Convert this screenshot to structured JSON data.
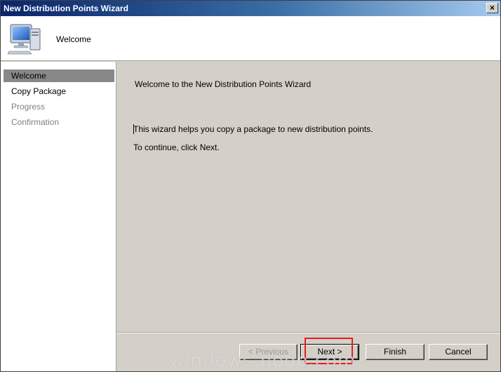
{
  "window": {
    "title": "New Distribution Points Wizard",
    "close_label": "×"
  },
  "header": {
    "title": "Welcome",
    "icon": "computer-icon"
  },
  "sidebar": {
    "items": [
      {
        "label": "Welcome",
        "state": "active"
      },
      {
        "label": "Copy Package",
        "state": "enabled"
      },
      {
        "label": "Progress",
        "state": "disabled"
      },
      {
        "label": "Confirmation",
        "state": "disabled"
      }
    ]
  },
  "content": {
    "heading": "Welcome to the New Distribution Points Wizard",
    "description": "This wizard helps you copy a package to new distribution points.",
    "continue_text": "To continue, click Next."
  },
  "footer": {
    "previous_label": "< Previous",
    "next_label": "Next >",
    "finish_label": "Finish",
    "cancel_label": "Cancel"
  },
  "watermark": "windows-noob.com",
  "colors": {
    "title_gradient_start": "#0a246a",
    "title_gradient_end": "#a6caf0",
    "dialog_background": "#d4d0c8",
    "highlight_box": "#e02020"
  }
}
